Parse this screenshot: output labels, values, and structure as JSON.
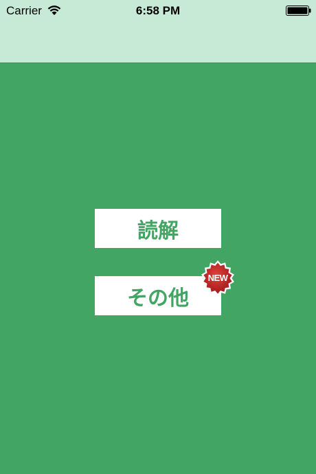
{
  "status_bar": {
    "carrier": "Carrier",
    "time": "6:58 PM",
    "icons": [
      "wifi-icon",
      "battery-icon"
    ]
  },
  "menu": {
    "reading_label": "読解",
    "other_label": "その他",
    "new_badge": "NEW"
  },
  "colors": {
    "background": "#42a563",
    "header": "#c6ead6",
    "button_bg": "#ffffff",
    "button_text": "#42a563",
    "badge": "#c42b25"
  }
}
